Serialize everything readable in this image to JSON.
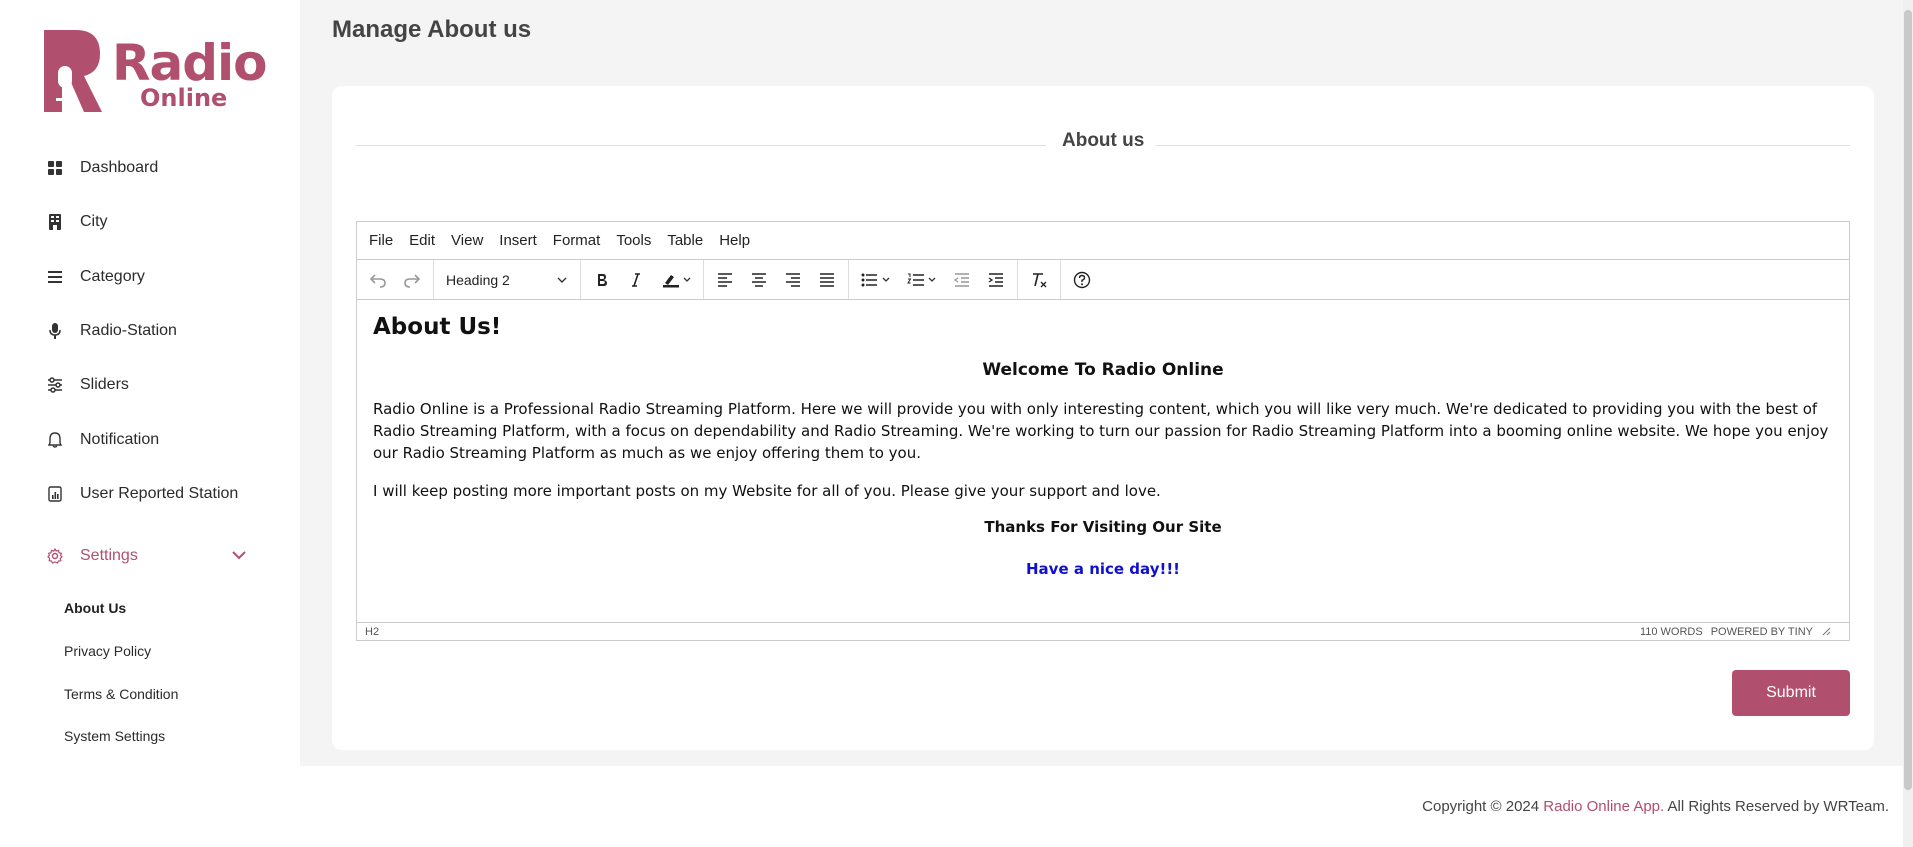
{
  "brand": {
    "name_line1": "Radio",
    "name_line2": "Online",
    "color": "#b14f6e"
  },
  "sidebar": {
    "items": [
      {
        "label": "Dashboard",
        "icon": "grid-icon"
      },
      {
        "label": "City",
        "icon": "building-icon"
      },
      {
        "label": "Category",
        "icon": "list-icon"
      },
      {
        "label": "Radio-Station",
        "icon": "microphone-icon"
      },
      {
        "label": "Sliders",
        "icon": "sliders-icon"
      },
      {
        "label": "Notification",
        "icon": "bell-icon"
      },
      {
        "label": "User Reported Station",
        "icon": "report-icon"
      },
      {
        "label": "Settings",
        "icon": "gear-icon",
        "active": true
      }
    ],
    "settings_sub": [
      {
        "label": "About Us",
        "current": true
      },
      {
        "label": "Privacy Policy"
      },
      {
        "label": "Terms & Condition"
      },
      {
        "label": "System Settings"
      }
    ]
  },
  "page": {
    "title": "Manage About us"
  },
  "card": {
    "title": "About us"
  },
  "editor": {
    "menu": [
      "File",
      "Edit",
      "View",
      "Insert",
      "Format",
      "Tools",
      "Table",
      "Help"
    ],
    "block_format": "Heading 2",
    "content": {
      "heading": "About Us!",
      "welcome": "Welcome To Radio Online",
      "para1": "Radio Online is a Professional Radio Streaming Platform. Here we will provide you with only interesting content, which you will like very much. We're dedicated to providing you with the best of Radio Streaming Platform, with a focus on dependability and Radio Streaming. We're working to turn our passion for Radio Streaming Platform into a booming online website. We hope you enjoy our Radio Streaming Platform as much as we enjoy offering them to you.",
      "para2": "I will keep posting more important posts on my Website for all of you. Please give your support and love.",
      "thanks": "Thanks For Visiting Our Site",
      "nice": "Have a nice day!!!",
      "nice_color": "#1010d0"
    },
    "status": {
      "path": "H2",
      "words": "110 WORDS",
      "powered": "POWERED BY TINY"
    }
  },
  "submit_label": "Submit",
  "footer": {
    "prefix": "Copyright © 2024 ",
    "link": "Radio Online App.",
    "suffix": " All Rights Reserved by WRTeam."
  }
}
